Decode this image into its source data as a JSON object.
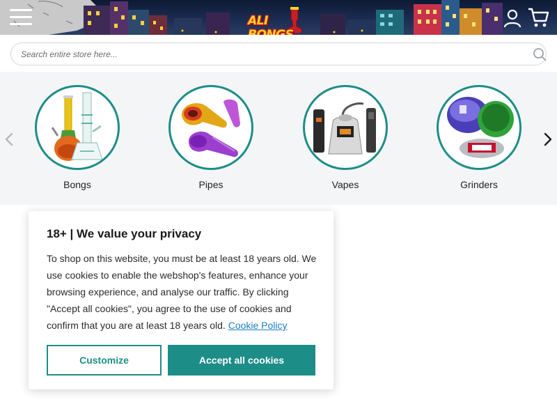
{
  "header": {
    "logo_text": "ALI BONGS",
    "icons": {
      "menu": "hamburger-menu-icon",
      "account": "user-icon",
      "cart": "shopping-cart-icon"
    }
  },
  "search": {
    "placeholder": "Search entire store here...",
    "value": "",
    "icon": "search-icon"
  },
  "categories": {
    "items": [
      {
        "label": "Bongs"
      },
      {
        "label": "Pipes"
      },
      {
        "label": "Vapes"
      },
      {
        "label": "Grinders"
      }
    ],
    "icons": {
      "prev": "chevron-left-icon",
      "next": "chevron-right-icon"
    }
  },
  "cookie_modal": {
    "title": "18+ | We value your privacy",
    "body": "To shop on this website, you must be at least 18 years old. We use cookies to enable the webshop's features, enhance your browsing experience, and analyse our traffic. By clicking \"Accept all cookies\", you agree to the use of cookies and confirm that you are at least 18 years old.",
    "policy_link": "Cookie Policy",
    "customize_label": "Customize",
    "accept_label": "Accept all cookies"
  },
  "colors": {
    "accent": "#1d8d88",
    "link": "#1a7fc4",
    "header_bg": "#1b2c52",
    "logo_yellow": "#ffd21f",
    "logo_red": "#c81e2a"
  }
}
